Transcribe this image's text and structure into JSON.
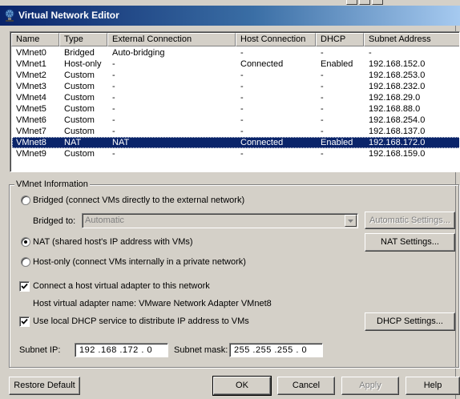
{
  "window": {
    "title": "Virtual Network Editor"
  },
  "network_list": {
    "columns": [
      "Name",
      "Type",
      "External Connection",
      "Host Connection",
      "DHCP",
      "Subnet Address"
    ],
    "rows": [
      {
        "name": "VMnet0",
        "type": "Bridged",
        "external": "Auto-bridging",
        "host": "-",
        "dhcp": "-",
        "subnet": "-"
      },
      {
        "name": "VMnet1",
        "type": "Host-only",
        "external": "-",
        "host": "Connected",
        "dhcp": "Enabled",
        "subnet": "192.168.152.0"
      },
      {
        "name": "VMnet2",
        "type": "Custom",
        "external": "-",
        "host": "-",
        "dhcp": "-",
        "subnet": "192.168.253.0"
      },
      {
        "name": "VMnet3",
        "type": "Custom",
        "external": "-",
        "host": "-",
        "dhcp": "-",
        "subnet": "192.168.232.0"
      },
      {
        "name": "VMnet4",
        "type": "Custom",
        "external": "-",
        "host": "-",
        "dhcp": "-",
        "subnet": "192.168.29.0"
      },
      {
        "name": "VMnet5",
        "type": "Custom",
        "external": "-",
        "host": "-",
        "dhcp": "-",
        "subnet": "192.168.88.0"
      },
      {
        "name": "VMnet6",
        "type": "Custom",
        "external": "-",
        "host": "-",
        "dhcp": "-",
        "subnet": "192.168.254.0"
      },
      {
        "name": "VMnet7",
        "type": "Custom",
        "external": "-",
        "host": "-",
        "dhcp": "-",
        "subnet": "192.168.137.0"
      },
      {
        "name": "VMnet8",
        "type": "NAT",
        "external": "NAT",
        "host": "Connected",
        "dhcp": "Enabled",
        "subnet": "192.168.172.0"
      },
      {
        "name": "VMnet9",
        "type": "Custom",
        "external": "-",
        "host": "-",
        "dhcp": "-",
        "subnet": "192.168.159.0"
      }
    ],
    "selected_row": "VMnet8"
  },
  "vmnet_info": {
    "group_title": "VMnet Information",
    "bridged_label": "Bridged (connect VMs directly to the external network)",
    "bridged_to_label": "Bridged to:",
    "bridged_to_value": "Automatic",
    "automatic_settings_label": "Automatic Settings...",
    "nat_label": "NAT (shared host's IP address with VMs)",
    "nat_settings_label": "NAT Settings...",
    "hostonly_label": "Host-only (connect VMs internally in a private network)",
    "selected_mode": "NAT",
    "connect_adapter_label": "Connect a host virtual adapter to this network",
    "connect_adapter_checked": true,
    "adapter_name_label": "Host virtual adapter name: VMware Network Adapter VMnet8",
    "dhcp_label": "Use local DHCP service to distribute IP address to VMs",
    "dhcp_checked": true,
    "dhcp_settings_label": "DHCP Settings...",
    "subnet_ip_label": "Subnet IP:",
    "subnet_ip_value": "192 .168 .172 .  0",
    "subnet_mask_label": "Subnet mask:",
    "subnet_mask_value": "255 .255 .255 .  0"
  },
  "footer": {
    "restore_default_label": "Restore Default",
    "ok_label": "OK",
    "cancel_label": "Cancel",
    "apply_label": "Apply",
    "help_label": "Help"
  },
  "colors": {
    "face": "#d4d0c8",
    "selection": "#0a246a",
    "title_start": "#0a246a",
    "title_end": "#a6caf0"
  }
}
